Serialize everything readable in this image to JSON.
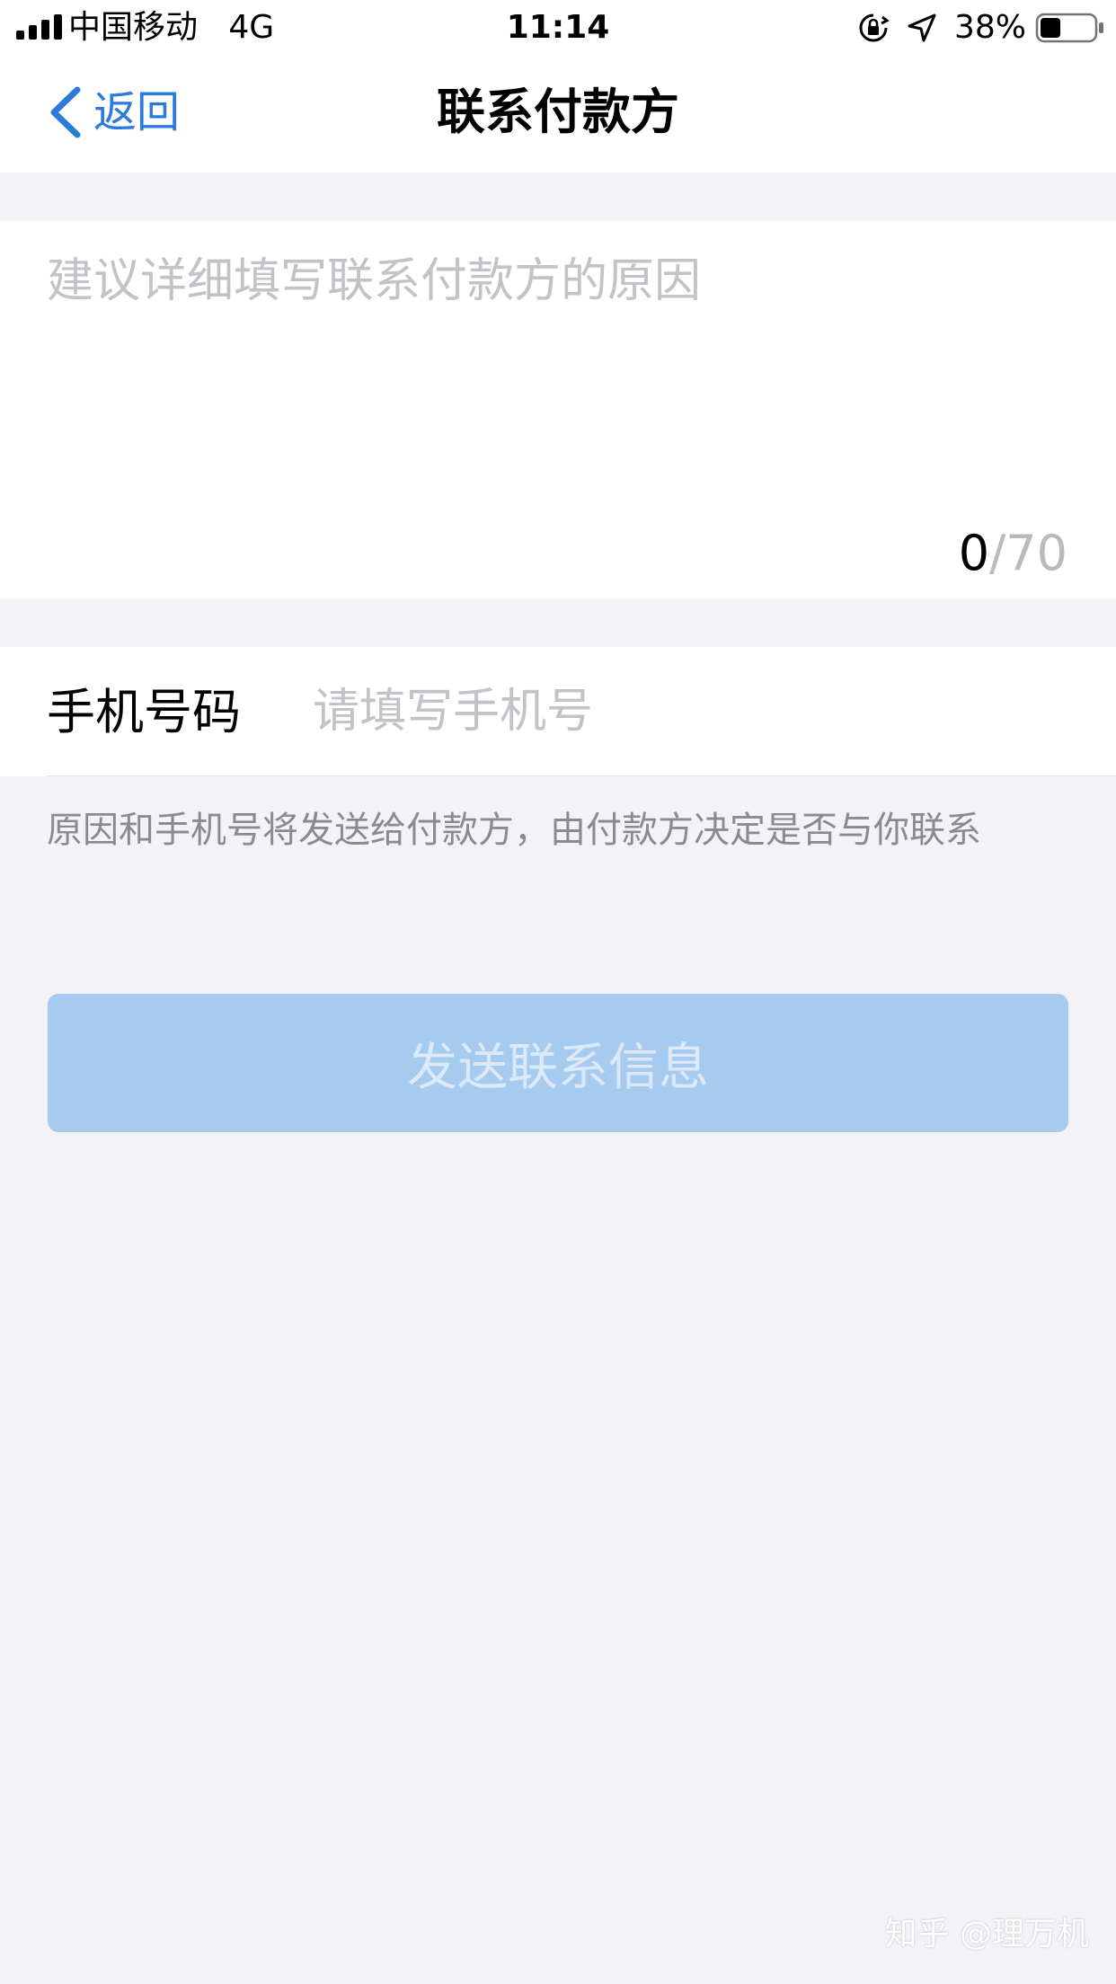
{
  "status_bar": {
    "carrier": "中国移动",
    "network": "4G",
    "time": "11:14",
    "battery_percent": "38%",
    "battery_level": 0.38
  },
  "nav": {
    "back_label": "返回",
    "title": "联系付款方"
  },
  "reason": {
    "placeholder": "建议详细填写联系付款方的原因",
    "value": "",
    "count_current": "0",
    "count_max": "/70"
  },
  "phone": {
    "label": "手机号码",
    "placeholder": "请填写手机号",
    "value": ""
  },
  "hint_text": "原因和手机号将发送给付款方，由付款方决定是否与你联系",
  "send_button_label": "发送联系信息",
  "watermark": "知乎 @理万机",
  "colors": {
    "accent": "#2d7bd9",
    "button_disabled_bg": "#a6cbef",
    "page_bg": "#f2f2f7"
  }
}
